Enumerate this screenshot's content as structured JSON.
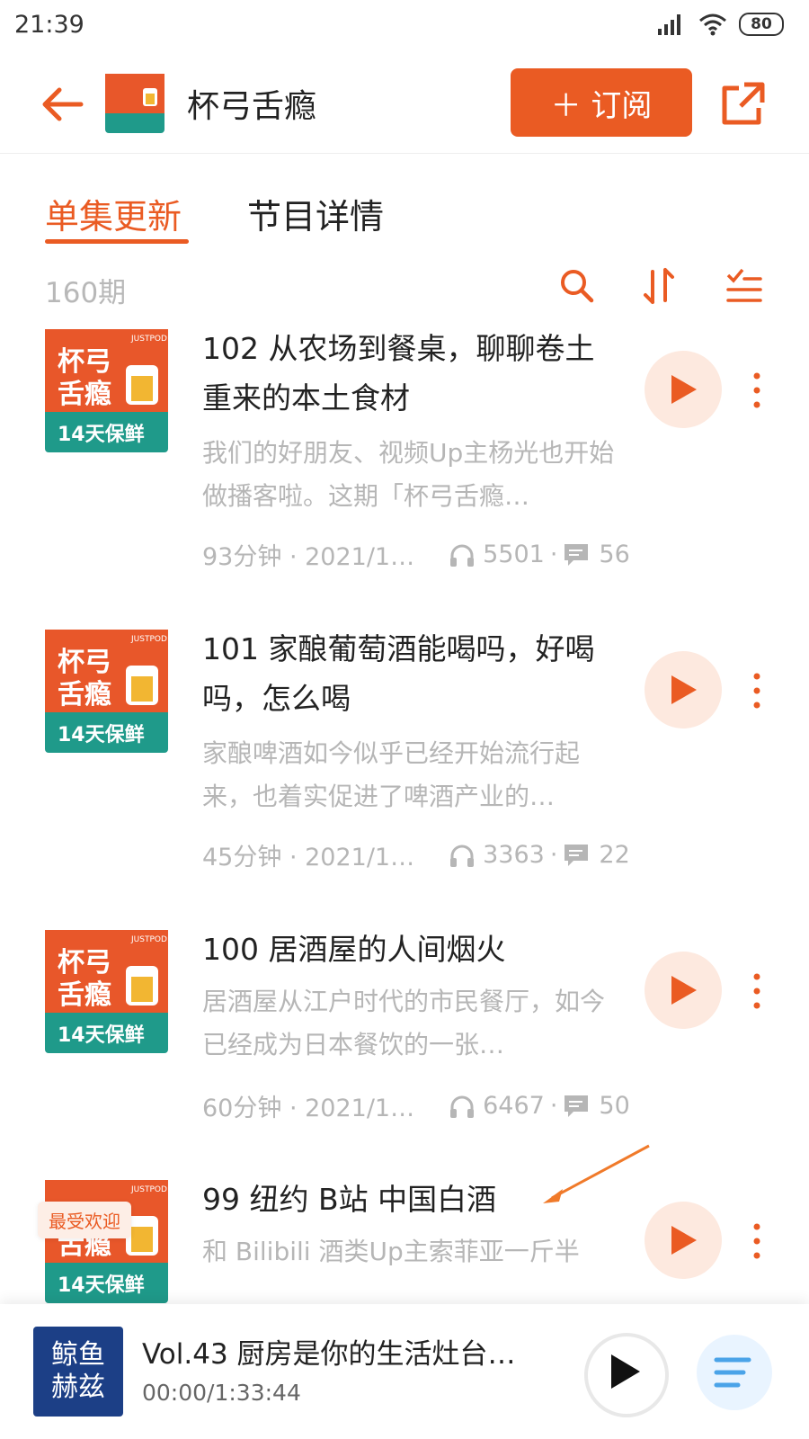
{
  "status_bar": {
    "time": "21:39",
    "battery": "80"
  },
  "header": {
    "podcast_title": "杯弓舌瘾",
    "subscribe_label": "＋ 订阅",
    "cover_text_top": "杯弓\n舌瘾",
    "cover_text_bottom": "14天保鲜"
  },
  "tabs": [
    {
      "label": "单集更新",
      "active": true
    },
    {
      "label": "节目详情",
      "active": false
    }
  ],
  "episode_count": "160期",
  "episodes": [
    {
      "title": "102 从农场到餐桌，聊聊卷土重来的本土食材",
      "desc": "我们的好朋友、视频Up主杨光也开始做播客啦。这期「杯弓舌瘾…",
      "meta": "93分钟 · 2021/1…",
      "plays": "5501",
      "comments": "56"
    },
    {
      "title": "101 家酿葡萄酒能喝吗，好喝吗，怎么喝",
      "desc": "家酿啤酒如今似乎已经开始流行起来，也着实促进了啤酒产业的…",
      "meta": "45分钟 · 2021/1…",
      "plays": "3363",
      "comments": "22"
    },
    {
      "title": "100 居酒屋的人间烟火",
      "desc": "居酒屋从江户时代的市民餐厅，如今已经成为日本餐饮的一张…",
      "meta": "60分钟 · 2021/1…",
      "plays": "6467",
      "comments": "50"
    },
    {
      "title": "99 纽约 B站 中国白酒",
      "desc": "和 Bilibili 酒类Up主索菲亚一斤半",
      "badge": "最受欢迎"
    }
  ],
  "cover_brand": "JUSTPOD",
  "player": {
    "title": "Vol.43 厨房是你的生活灶台，…",
    "time": "00:00/1:33:44",
    "cover_text": "鲸鱼\n赫兹"
  },
  "colors": {
    "accent": "#ea5b23",
    "muted": "#b6b6b6",
    "play_bg": "#fde9df"
  }
}
